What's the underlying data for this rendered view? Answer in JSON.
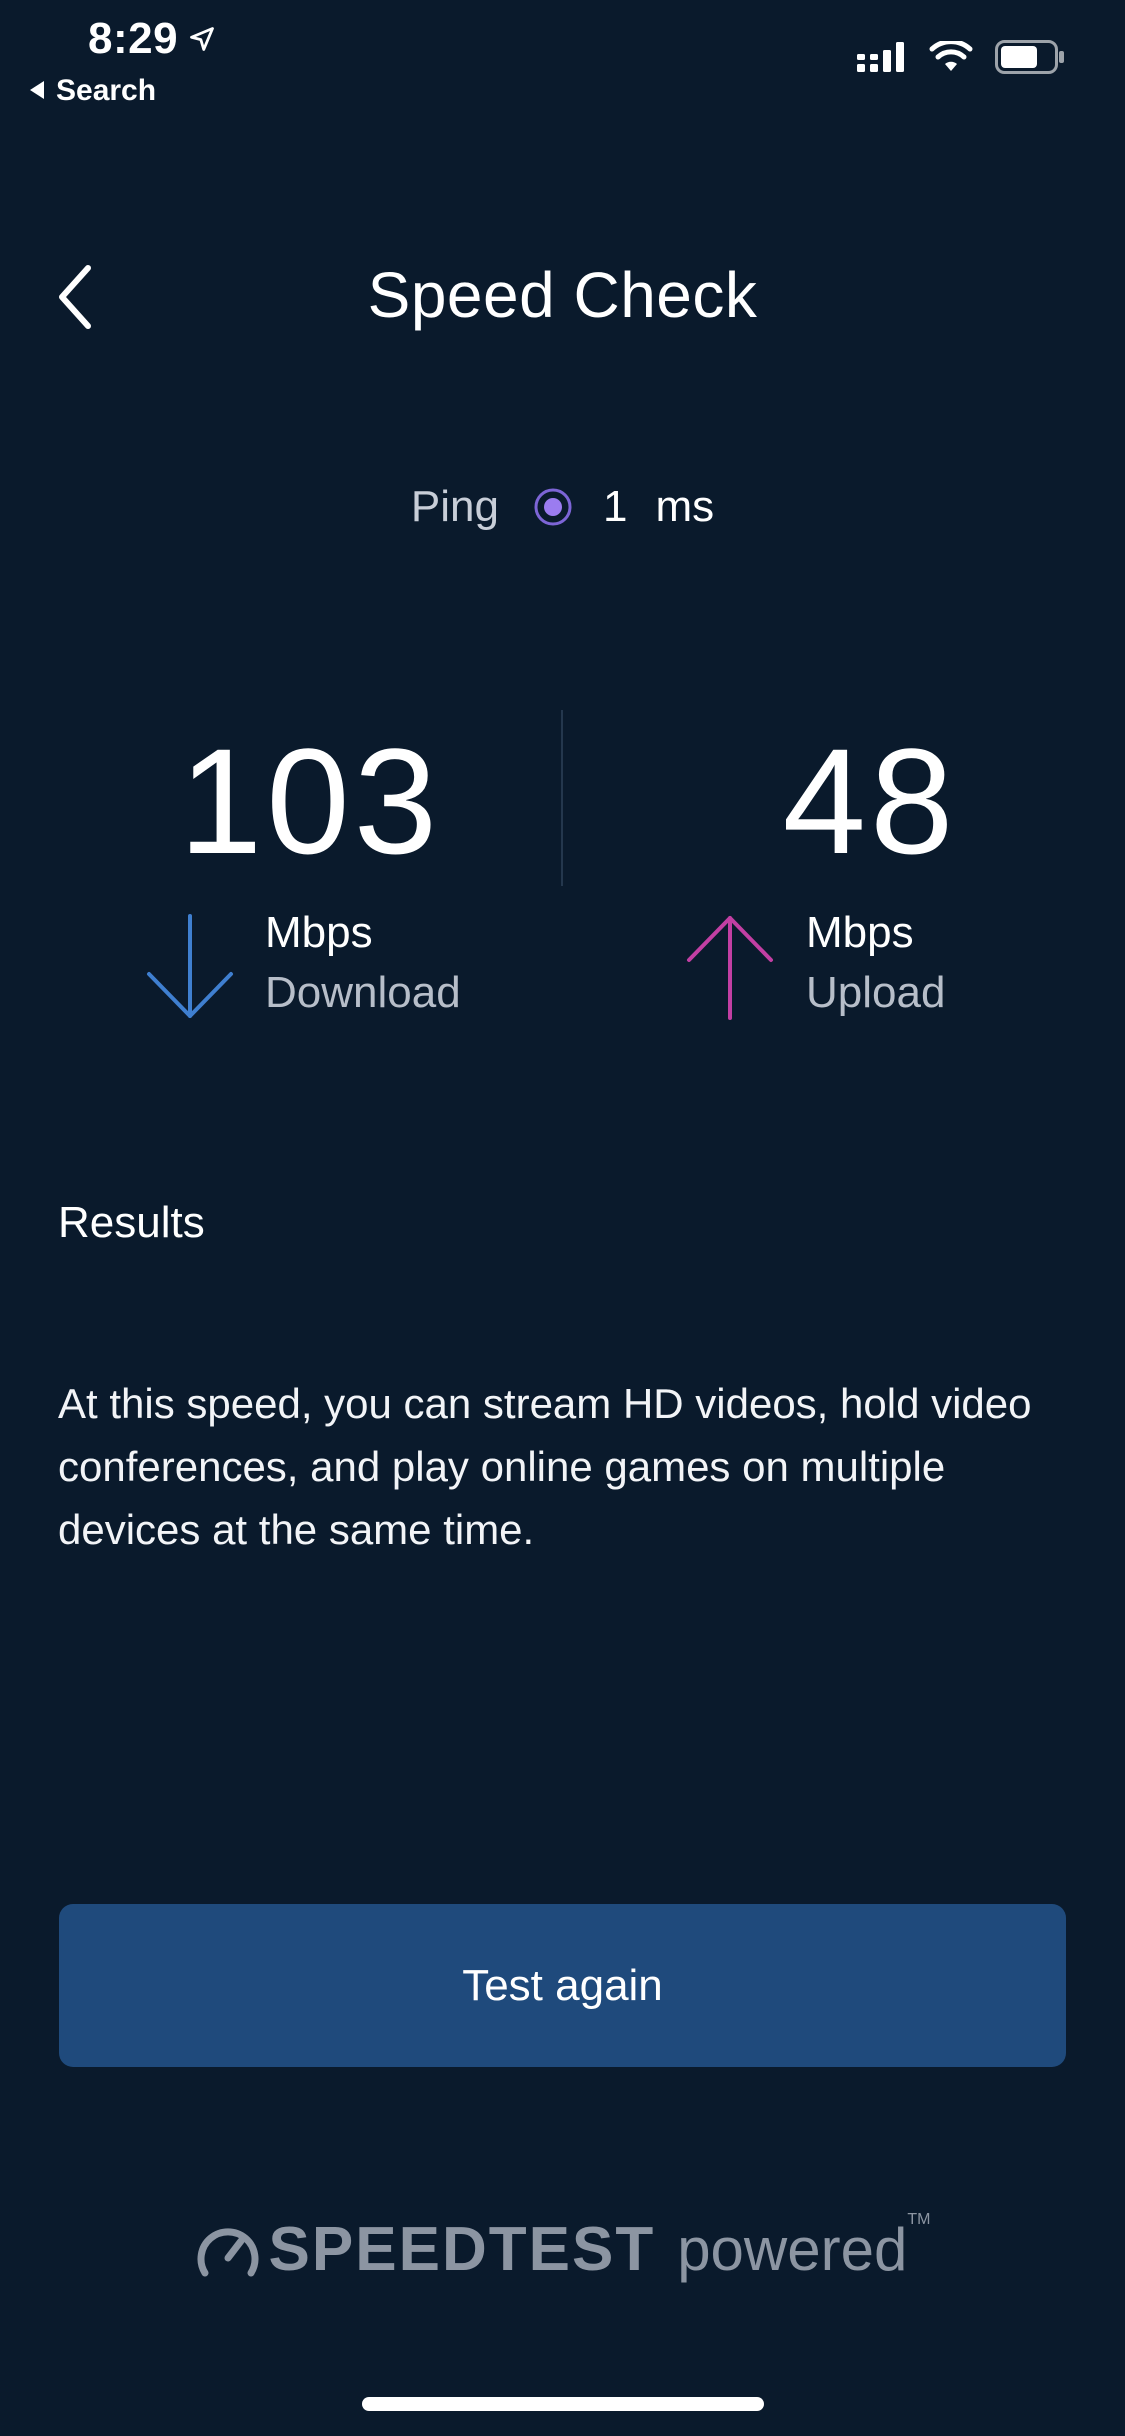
{
  "status_bar": {
    "time": "8:29",
    "back_label": "Search"
  },
  "header": {
    "title": "Speed Check"
  },
  "ping": {
    "label": "Ping",
    "value": "1",
    "unit": "ms"
  },
  "download": {
    "value": "103",
    "unit": "Mbps",
    "label": "Download"
  },
  "upload": {
    "value": "48",
    "unit": "Mbps",
    "label": "Upload"
  },
  "results": {
    "title": "Results",
    "description": "At this speed, you can stream HD videos, hold video conferences, and play online games on multiple devices at the same time."
  },
  "actions": {
    "test_again_label": "Test again"
  },
  "footer": {
    "brand": "SPEEDTEST",
    "powered": "powered",
    "tm": "TM"
  },
  "colors": {
    "background": "#0a1a2c",
    "button": "#1f4a7c",
    "download_arrow": "#3f7fd0",
    "upload_arrow": "#c23fa3",
    "ping_dot": "#9b7cf0"
  }
}
